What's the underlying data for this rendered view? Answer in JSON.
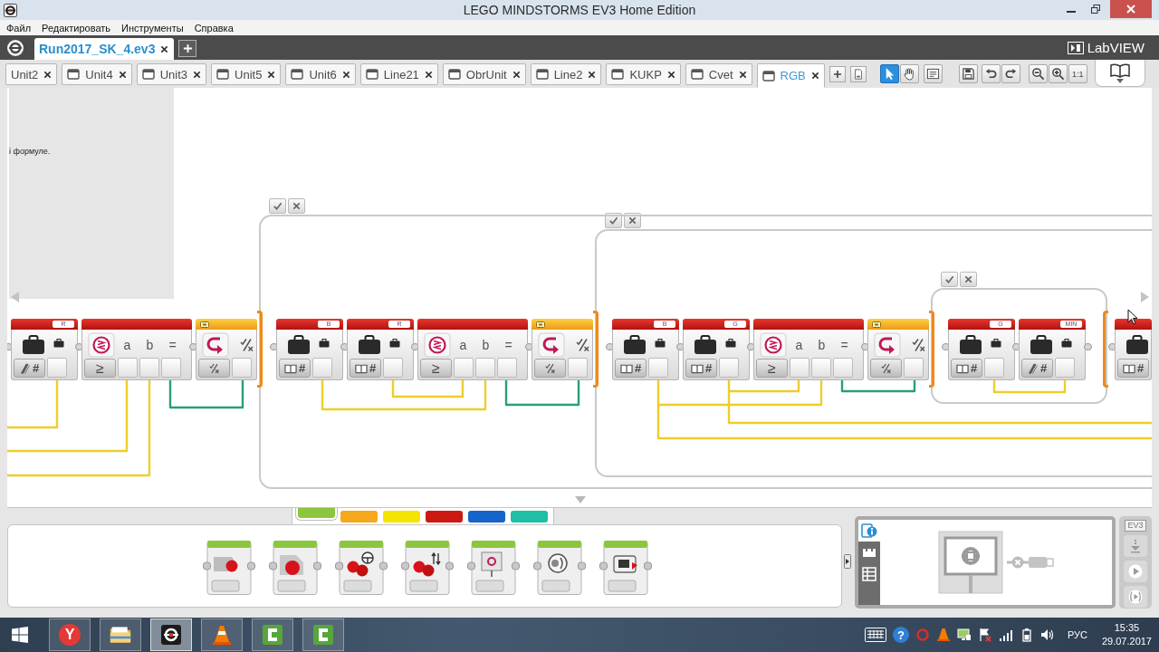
{
  "window": {
    "title": "LEGO MINDSTORMS EV3 Home Edition"
  },
  "menu": [
    "Файл",
    "Редактировать",
    "Инструменты",
    "Справка"
  ],
  "project_tabs": [
    {
      "label": "Run2017_SK_4.ev3",
      "selected": true
    }
  ],
  "brand": "LabVIEW",
  "program_tabs": [
    {
      "label": "Unit2",
      "icon": false,
      "selected": false
    },
    {
      "label": "Unit4",
      "icon": true,
      "selected": false
    },
    {
      "label": "Unit3",
      "icon": true,
      "selected": false
    },
    {
      "label": "Unit5",
      "icon": true,
      "selected": false
    },
    {
      "label": "Unit6",
      "icon": true,
      "selected": false
    },
    {
      "label": "Line21",
      "icon": true,
      "selected": false
    },
    {
      "label": "ObrUnit",
      "icon": true,
      "selected": false
    },
    {
      "label": "Line2",
      "icon": true,
      "selected": false
    },
    {
      "label": "KUKP",
      "icon": true,
      "selected": false
    },
    {
      "label": "Cvet",
      "icon": true,
      "selected": false
    },
    {
      "label": "RGB",
      "icon": true,
      "selected": true
    }
  ],
  "tools": [
    {
      "kind": "select",
      "selected": true
    },
    {
      "kind": "pan",
      "selected": false
    },
    {
      "kind": "comment",
      "selected": false
    }
  ],
  "actions": [
    {
      "kind": "save"
    },
    {
      "kind": "undo"
    },
    {
      "kind": "redo"
    },
    {
      "kind": "zoom_out"
    },
    {
      "kind": "zoom_in"
    },
    {
      "kind": "zoom_reset",
      "label": "1:1"
    }
  ],
  "canvas": {
    "comment": "і формуле.",
    "sequence": [
      {
        "kind": "variable",
        "name": "R",
        "writes": true,
        "type_symbol": "#"
      },
      {
        "kind": "compare",
        "operator": "≥",
        "inputs": [
          "a",
          "b"
        ],
        "result": "="
      },
      {
        "kind": "switch",
        "children": [
          {
            "kind": "variable",
            "name": "B",
            "writes": false,
            "type_symbol": "#"
          },
          {
            "kind": "variable",
            "name": "R",
            "writes": false,
            "type_symbol": "#"
          },
          {
            "kind": "compare",
            "operator": "≥",
            "inputs": [
              "a",
              "b"
            ],
            "result": "="
          },
          {
            "kind": "switch",
            "children": [
              {
                "kind": "variable",
                "name": "B",
                "writes": false,
                "type_symbol": "#"
              },
              {
                "kind": "variable",
                "name": "G",
                "writes": false,
                "type_symbol": "#"
              },
              {
                "kind": "compare",
                "operator": "≥",
                "inputs": [
                  "a",
                  "b"
                ],
                "result": "="
              },
              {
                "kind": "switch",
                "children": [
                  {
                    "kind": "variable",
                    "name": "G",
                    "writes": false,
                    "type_symbol": "#"
                  },
                  {
                    "kind": "variable",
                    "name": "MIN",
                    "writes": true,
                    "type_symbol": "#"
                  }
                ]
              },
              {
                "kind": "variable",
                "writes": false,
                "type_symbol": "#"
              }
            ]
          }
        ]
      }
    ]
  },
  "palette": {
    "tabs": [
      {
        "color": "#8cc63f",
        "selected": true
      },
      {
        "color": "#f6a81c",
        "selected": false
      },
      {
        "color": "#f4e400",
        "selected": false
      },
      {
        "color": "#cc1a12",
        "selected": false
      },
      {
        "color": "#1565c8",
        "selected": false
      },
      {
        "color": "#1ebfa6",
        "selected": false
      }
    ],
    "blocks": [
      {
        "kind": "medium_motor"
      },
      {
        "kind": "large_motor"
      },
      {
        "kind": "move_steering"
      },
      {
        "kind": "move_tank"
      },
      {
        "kind": "display"
      },
      {
        "kind": "sound"
      },
      {
        "kind": "brick_status_light"
      }
    ]
  },
  "hardware_page": {
    "tabs": [
      {
        "kind": "brick_info",
        "selected": true
      },
      {
        "kind": "port_view",
        "selected": false
      },
      {
        "kind": "available_bricks",
        "selected": false
      }
    ],
    "connected": false
  },
  "brick_controls": {
    "label": "EV3",
    "buttons": [
      {
        "kind": "download"
      },
      {
        "kind": "run"
      },
      {
        "kind": "run_selected"
      }
    ]
  },
  "taskbar": {
    "apps": [
      {
        "kind": "browser",
        "label": "Y",
        "selected": false
      },
      {
        "kind": "files",
        "selected": false
      },
      {
        "kind": "ev3",
        "selected": true
      },
      {
        "kind": "media_player",
        "selected": false
      },
      {
        "kind": "recorder",
        "selected": false
      },
      {
        "kind": "recorder",
        "selected": false
      }
    ],
    "tray": [
      {
        "kind": "keyboard"
      },
      {
        "kind": "help",
        "glyph": "?"
      },
      {
        "kind": "ring"
      },
      {
        "kind": "media_player"
      },
      {
        "kind": "network"
      },
      {
        "kind": "flag"
      },
      {
        "kind": "signal"
      },
      {
        "kind": "battery"
      },
      {
        "kind": "volume"
      }
    ],
    "language": "РУС",
    "time": "15:35",
    "date": "29.07.2017"
  }
}
